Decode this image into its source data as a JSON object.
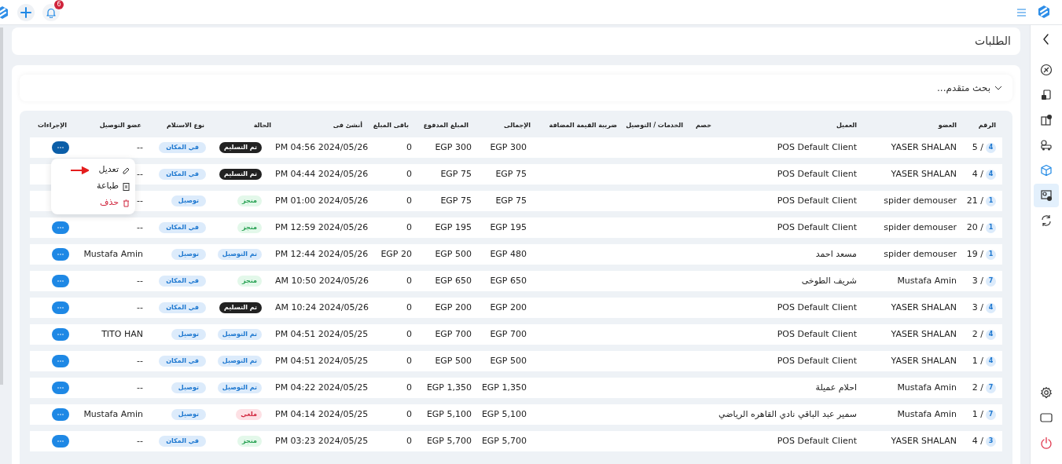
{
  "topbar": {
    "notifications_count": "6"
  },
  "sidebar": {
    "items": [
      {
        "selected": false
      },
      {
        "selected": false
      },
      {
        "selected": false
      },
      {
        "selected": false
      },
      {
        "selected": false
      },
      {
        "selected": true
      },
      {
        "selected": false
      },
      {
        "selected": false
      }
    ]
  },
  "page_title": "الطلبات",
  "search": {
    "label": "بحث متقدم...",
    "expanded": false
  },
  "table": {
    "columns": [
      "الرقم",
      "العضو",
      "العميل",
      "خصم",
      "الخدمات / التوصيل",
      "ضريبة القيمة المضافة",
      "الإجمالى",
      "المبلغ المدفوع",
      "باقى المبلغ",
      "أنشئ فى",
      "الحالة",
      "نوع الاستلام",
      "عضو التوصيل",
      "الإجراءات"
    ],
    "rows": [
      {
        "number": "5 /",
        "branch": "4",
        "member": "YASER SHALAN",
        "client": "POS Default Client",
        "total": "EGP 300",
        "paid": "EGP 300",
        "remaining": "0",
        "created": "PM 04:56 2024/05/26",
        "status": "تم التسليم",
        "color": "#222222",
        "receipt": "في المكان",
        "courier": "--",
        "menu_open": true
      },
      {
        "number": "4 /",
        "branch": "4",
        "member": "YASER SHALAN",
        "client": "POS Default Client",
        "total": "EGP 75",
        "paid": "EGP 75",
        "remaining": "0",
        "created": "PM 04:44 2024/05/26",
        "status": "تم التسليم",
        "color": "#222222",
        "receipt": "في المكان",
        "courier": "--"
      },
      {
        "number": "21 /",
        "branch": "1",
        "member": "spider demouser",
        "client": "POS Default Client",
        "total": "EGP 75",
        "paid": "EGP 75",
        "remaining": "0",
        "created": "PM 01:00 2024/05/26",
        "status": "منجز",
        "color": "#e3f8ea",
        "receipt": "توصيل",
        "courier": "--"
      },
      {
        "number": "20 /",
        "branch": "1",
        "member": "spider demouser",
        "client": "POS Default Client",
        "total": "EGP 195",
        "paid": "EGP 195",
        "remaining": "0",
        "created": "PM 12:59 2024/05/26",
        "status": "منجز",
        "color": "#e3f8ea",
        "receipt": "في المكان",
        "courier": "--",
        "menu_open": false
      },
      {
        "number": "19 /",
        "branch": "1",
        "member": "spider demouser",
        "client": "مسعد احمد",
        "total": "EGP 480",
        "paid": "EGP 500",
        "remaining": "EGP 20",
        "created": "PM 12:44 2024/05/26",
        "status": "تم التوصيل",
        "color": "#dcebfb",
        "receipt": "توصيل",
        "courier": "Mustafa Amin",
        "menu_open": false
      },
      {
        "number": "3 /",
        "branch": "7",
        "member": "Mustafa Amin",
        "client": "شريف الطوخى",
        "total": "EGP 650",
        "paid": "EGP 650",
        "remaining": "0",
        "created": "AM 10:50 2024/05/26",
        "status": "منجز",
        "color": "#e3f8ea",
        "receipt": "في المكان",
        "courier": "--",
        "menu_open": false
      },
      {
        "number": "3 /",
        "branch": "4",
        "member": "YASER SHALAN",
        "client": "POS Default Client",
        "total": "EGP 200",
        "paid": "EGP 200",
        "remaining": "0",
        "created": "AM 10:24 2024/05/26",
        "status": "تم التسليم",
        "color": "#222222",
        "receipt": "في المكان",
        "courier": "--",
        "menu_open": false
      },
      {
        "number": "2 /",
        "branch": "4",
        "member": "YASER SHALAN",
        "client": "POS Default Client",
        "total": "EGP 700",
        "paid": "EGP 700",
        "remaining": "0",
        "created": "PM 04:51 2024/05/25",
        "status": "تم التوصيل",
        "color": "#dcebfb",
        "receipt": "توصيل",
        "courier": "TITO HAN",
        "menu_open": false
      },
      {
        "number": "1 /",
        "branch": "4",
        "member": "YASER SHALAN",
        "client": "POS Default Client",
        "total": "EGP 500",
        "paid": "EGP 500",
        "remaining": "0",
        "created": "PM 04:51 2024/05/25",
        "status": "تم التوصيل",
        "color": "#dcebfb",
        "receipt": "في المكان",
        "courier": "--",
        "menu_open": false
      },
      {
        "number": "2 /",
        "branch": "7",
        "member": "Mustafa Amin",
        "client": "احلام عميلة",
        "total": "EGP 1,350",
        "paid": "EGP 1,350",
        "remaining": "0",
        "created": "PM 04:22 2024/05/25",
        "status": "تم التوصيل",
        "color": "#dcebfb",
        "receipt": "توصيل",
        "courier": "--",
        "menu_open": false
      },
      {
        "number": "1 /",
        "branch": "7",
        "member": "Mustafa Amin",
        "client": "سمير عبد الباقي نادي القاهره الرياضي",
        "total": "EGP 5,100",
        "paid": "EGP 5,100",
        "remaining": "0",
        "created": "PM 04:14 2024/05/25",
        "status": "ملغي",
        "color": "#fde0e4",
        "receipt": "توصيل",
        "courier": "Mustafa Amin",
        "menu_open": false
      },
      {
        "number": "4 /",
        "branch": "3",
        "member": "YASER SHALAN",
        "client": "POS Default Client",
        "total": "EGP 5,700",
        "paid": "EGP 5,700",
        "remaining": "0",
        "created": "PM 03:23 2024/05/25",
        "status": "منجز",
        "color": "#e3f8ea",
        "receipt": "في المكان",
        "courier": "--",
        "menu_open": false
      }
    ]
  },
  "action_menu": {
    "items": [
      {
        "label": "تعديل",
        "kind": "edit",
        "pointed": true
      },
      {
        "label": "طباعة",
        "kind": "print",
        "pointed": false
      },
      {
        "label": "حذف",
        "kind": "delete",
        "pointed": false
      }
    ]
  }
}
